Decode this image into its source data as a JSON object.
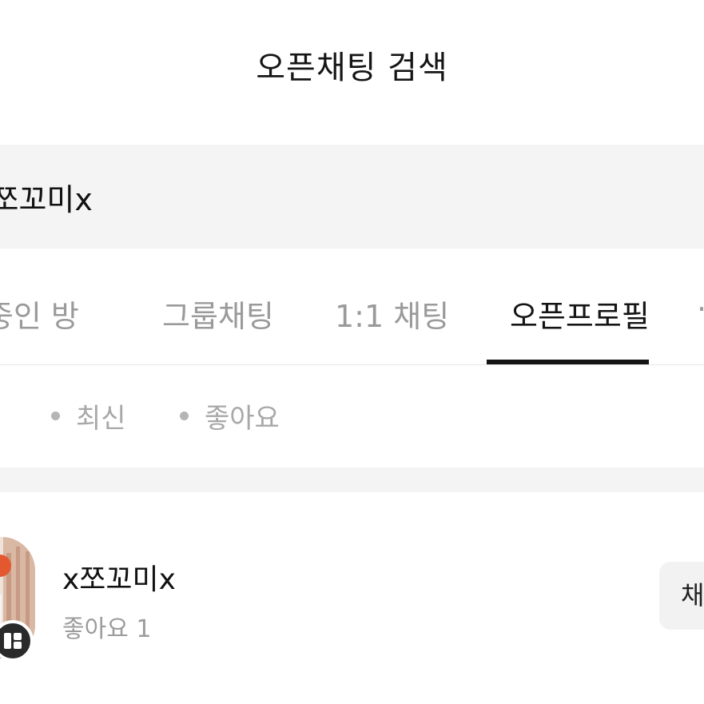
{
  "header": {
    "title": "오픈채팅 검색"
  },
  "search": {
    "query": "x쪼꼬미x"
  },
  "tabs": [
    {
      "label": "대화중인 방"
    },
    {
      "label": "그룹채팅"
    },
    {
      "label": "1:1 채팅"
    },
    {
      "label": "오픈프로필",
      "active": true
    },
    {
      "label": "·"
    }
  ],
  "sort": {
    "options": [
      {
        "label": "최신"
      },
      {
        "label": "좋아요"
      }
    ]
  },
  "results": [
    {
      "name": "x쪼꼬미x",
      "likes": "좋아요 1",
      "button_label": "채팅",
      "avatar_icon": "profile-photo",
      "badge_icon": "open-profile-badge-icon"
    }
  ],
  "colors": {
    "accent": "#141414",
    "search_bg": "#f4f4f4",
    "inactive_text": "#9a9a9a",
    "badge_bg": "#2a2a2a"
  }
}
